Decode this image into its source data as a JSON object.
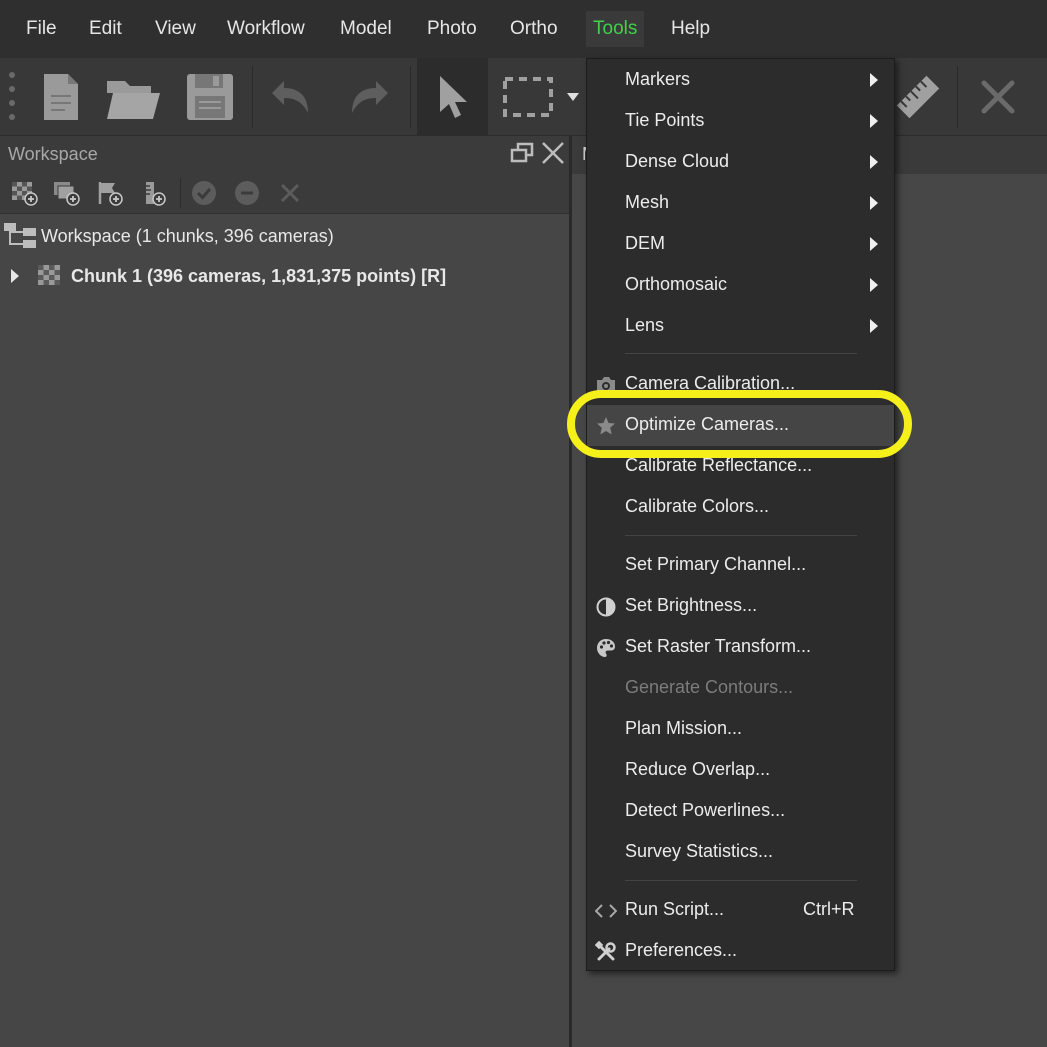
{
  "menubar": {
    "items": [
      "File",
      "Edit",
      "View",
      "Workflow",
      "Model",
      "Photo",
      "Ortho",
      "Tools",
      "Help"
    ],
    "active": "Tools",
    "active_color": "#3fd14a"
  },
  "toolbar": {
    "icons": [
      "new-document-icon",
      "open-folder-icon",
      "save-icon",
      "undo-icon",
      "redo-icon",
      "navigation-arrow-icon",
      "rectangle-selection-icon",
      "dropdown-arrow-icon",
      "ruler-icon",
      "delete-icon"
    ]
  },
  "workspace": {
    "title": "Workspace",
    "tree": {
      "root_label": "Workspace (1 chunks, 396 cameras)",
      "chunk_label": "Chunk 1 (396 cameras, 1,831,375 points) [R]"
    }
  },
  "right_panel": {
    "tab_label": "M"
  },
  "tools_menu": {
    "items": [
      {
        "label": "Markers",
        "submenu": true
      },
      {
        "label": "Tie Points",
        "submenu": true
      },
      {
        "label": "Dense Cloud",
        "submenu": true
      },
      {
        "label": "Mesh",
        "submenu": true
      },
      {
        "label": "DEM",
        "submenu": true
      },
      {
        "label": "Orthomosaic",
        "submenu": true
      },
      {
        "label": "Lens",
        "submenu": true
      },
      {
        "label": "Camera Calibration...",
        "icon": "camera-icon"
      },
      {
        "label": "Optimize Cameras...",
        "icon": "star-icon",
        "highlighted": true
      },
      {
        "label": "Calibrate Reflectance..."
      },
      {
        "label": "Calibrate Colors..."
      },
      {
        "label": "Set Primary Channel..."
      },
      {
        "label": "Set Brightness...",
        "icon": "contrast-icon"
      },
      {
        "label": "Set Raster Transform...",
        "icon": "palette-icon"
      },
      {
        "label": "Generate Contours...",
        "disabled": true
      },
      {
        "label": "Plan Mission..."
      },
      {
        "label": "Reduce Overlap..."
      },
      {
        "label": "Detect Powerlines..."
      },
      {
        "label": "Survey Statistics..."
      },
      {
        "label": "Run Script...",
        "icon": "code-icon",
        "shortcut": "Ctrl+R"
      },
      {
        "label": "Preferences...",
        "icon": "tools-icon"
      }
    ]
  },
  "annotation": {
    "highlight_color": "#f5f01a"
  }
}
